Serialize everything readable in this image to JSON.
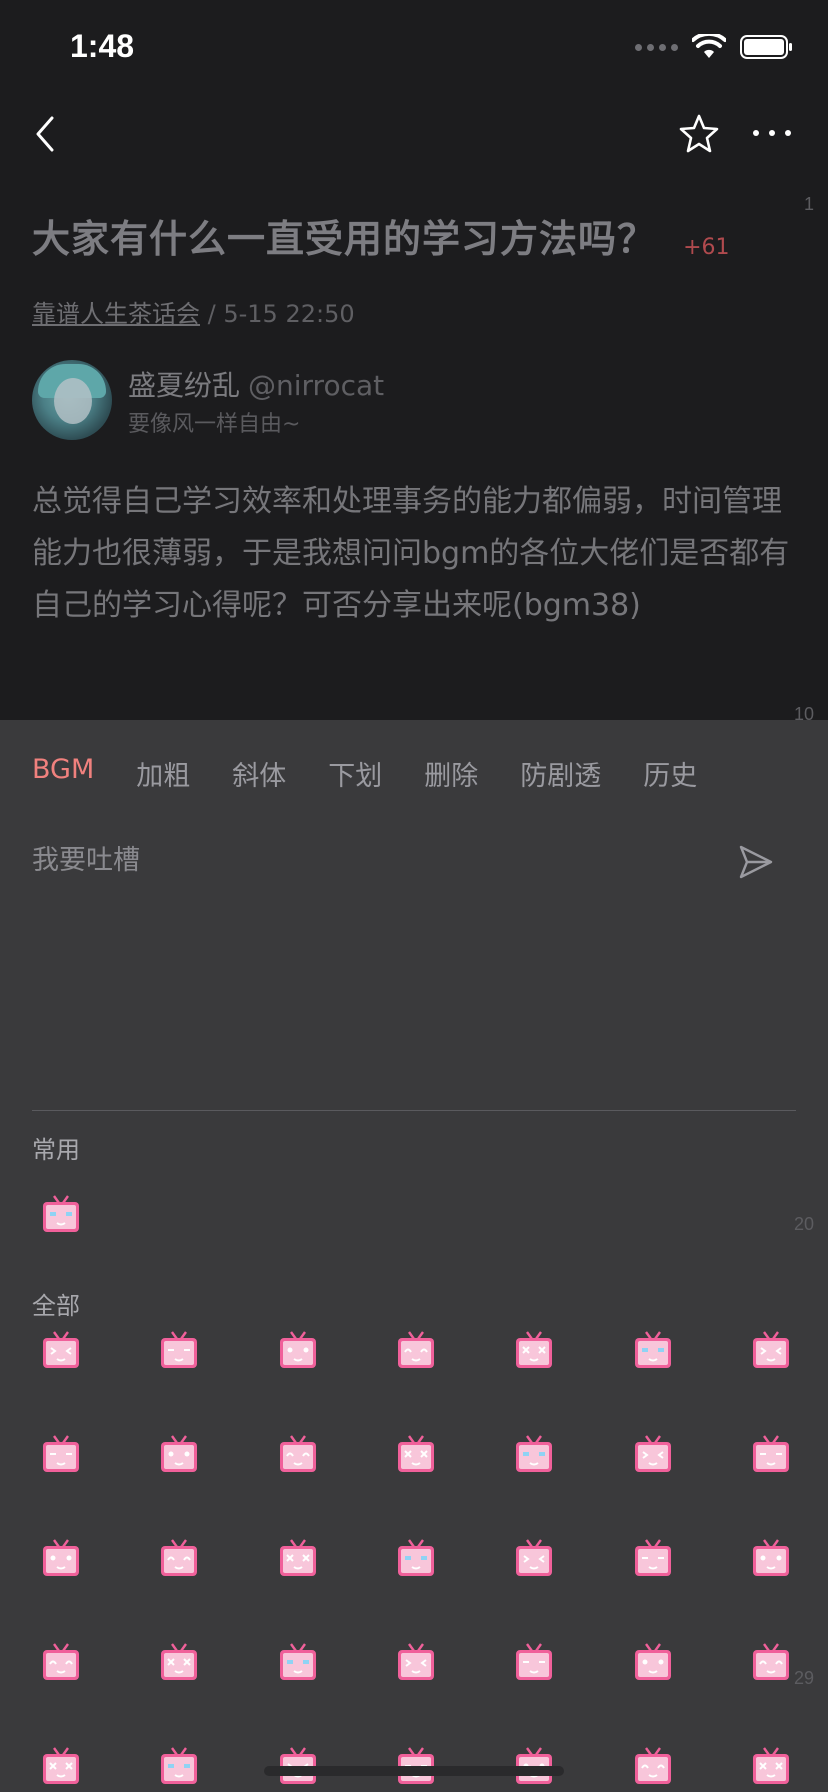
{
  "status": {
    "time": "1:48"
  },
  "nav": {
    "back_icon": "chevron-left-icon",
    "star_icon": "star-icon",
    "more_icon": "ellipsis-icon"
  },
  "page_markers": [
    "1",
    "10",
    "20",
    "29"
  ],
  "post": {
    "title": "大家有什么一直受用的学习方法吗？",
    "score": "+61",
    "group": "靠谱人生茶话会",
    "separator": " / ",
    "date": "5-15 22:50",
    "author_name": "盛夏纷乱",
    "author_handle": "@nirrocat",
    "author_sign": "要像风一样自由~",
    "body": "总觉得自己学习效率和处理事务的能力都偏弱，时间管理能力也很薄弱，于是我想问问bgm的各位大佬们是否都有自己的学习心得呢？可否分享出来呢(bgm38)"
  },
  "composer": {
    "tabs": [
      "BGM",
      "加粗",
      "斜体",
      "下划",
      "删除",
      "防剧透",
      "历史"
    ],
    "active_tab": "BGM",
    "placeholder": "我要吐槽",
    "send_icon": "send-icon",
    "common_label": "常用",
    "all_label": "全部"
  },
  "colors": {
    "background": "#1c1c1e",
    "panel": "#3a3a3c",
    "accent": "#f0817e",
    "score": "#b04a4e",
    "emoji_pink": "#f0609a"
  }
}
